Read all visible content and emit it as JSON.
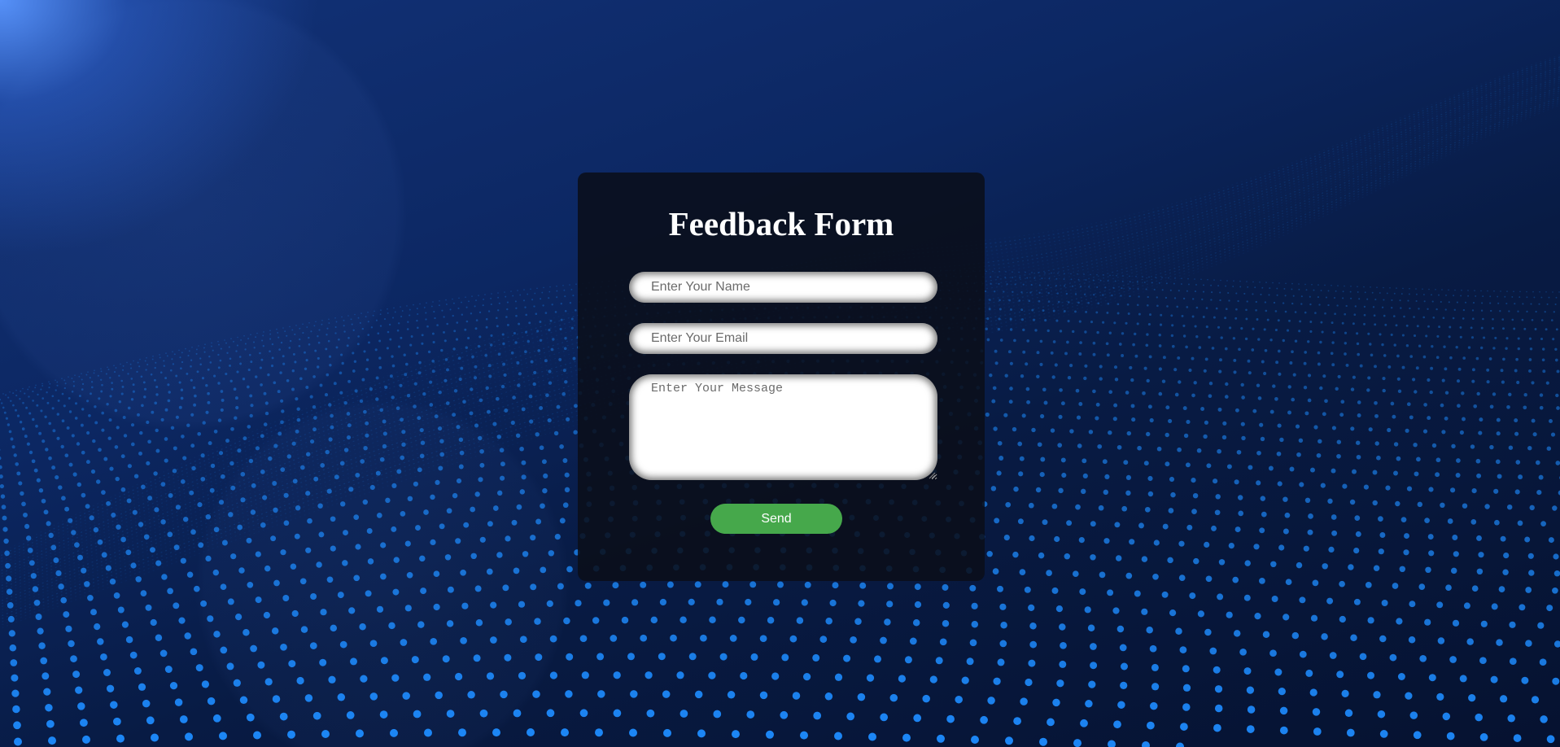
{
  "form": {
    "title": "Feedback Form",
    "name_placeholder": "Enter Your Name",
    "email_placeholder": "Enter Your Email",
    "message_placeholder": "Enter Your Message",
    "send_label": "Send"
  },
  "colors": {
    "background": "#0a1f4d",
    "card": "#0a0e18",
    "send_button": "#46a84b",
    "accent_dots": "#1e8cff"
  }
}
